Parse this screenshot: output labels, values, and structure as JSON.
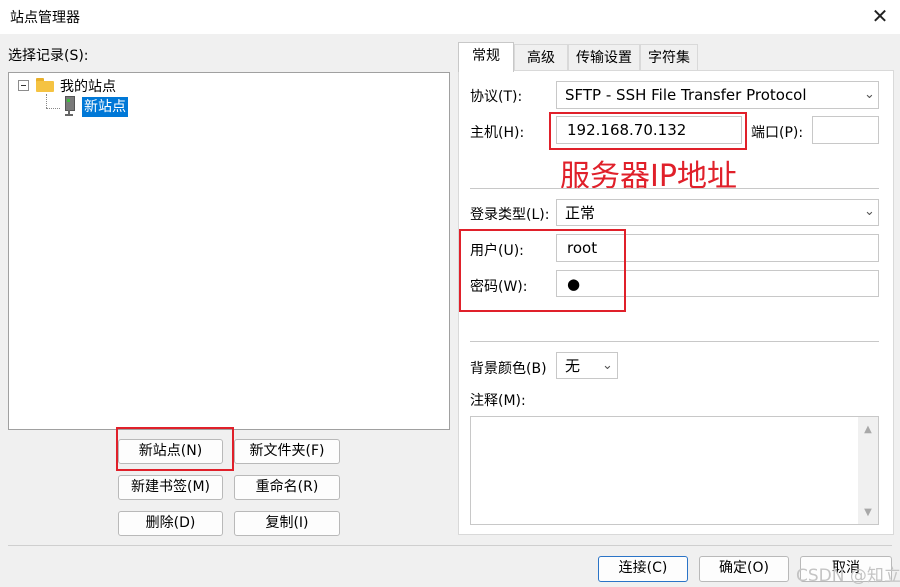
{
  "window": {
    "title": "站点管理器",
    "close_glyph": "✕"
  },
  "left": {
    "select_label": "选择记录(S):",
    "tree": {
      "root_label": "我的站点",
      "selected_label": "新站点"
    },
    "buttons": {
      "new_site": "新站点(N)",
      "new_folder": "新文件夹(F)",
      "new_bookmark": "新建书签(M)",
      "rename": "重命名(R)",
      "delete": "删除(D)",
      "copy": "复制(I)"
    }
  },
  "tabs": [
    {
      "label": "常规"
    },
    {
      "label": "高级"
    },
    {
      "label": "传输设置"
    },
    {
      "label": "字符集"
    }
  ],
  "general": {
    "protocol_label": "协议(T):",
    "protocol_value": "SFTP - SSH File Transfer Protocol",
    "host_label": "主机(H):",
    "host_value": "192.168.70.132",
    "port_label": "端口(P):",
    "port_value": "",
    "annotation": "服务器IP地址",
    "logon_type_label": "登录类型(L):",
    "logon_type_value": "正常",
    "user_label": "用户(U):",
    "user_value": "root",
    "password_label": "密码(W):",
    "password_value": "●",
    "bg_color_label": "背景颜色(B)",
    "bg_color_value": "无",
    "comments_label": "注释(M):"
  },
  "footer": {
    "connect": "连接(C)",
    "ok": "确定(O)",
    "cancel": "取消"
  },
  "watermark": "CSDN @知立",
  "icons": {
    "close": "close-icon",
    "folder": "folder-icon",
    "server": "server-icon",
    "chevron": "chevron-down-icon"
  },
  "colors": {
    "accent": "#0078d7",
    "annotation_red": "#e0202a",
    "default_button_border": "#2b74c7"
  }
}
